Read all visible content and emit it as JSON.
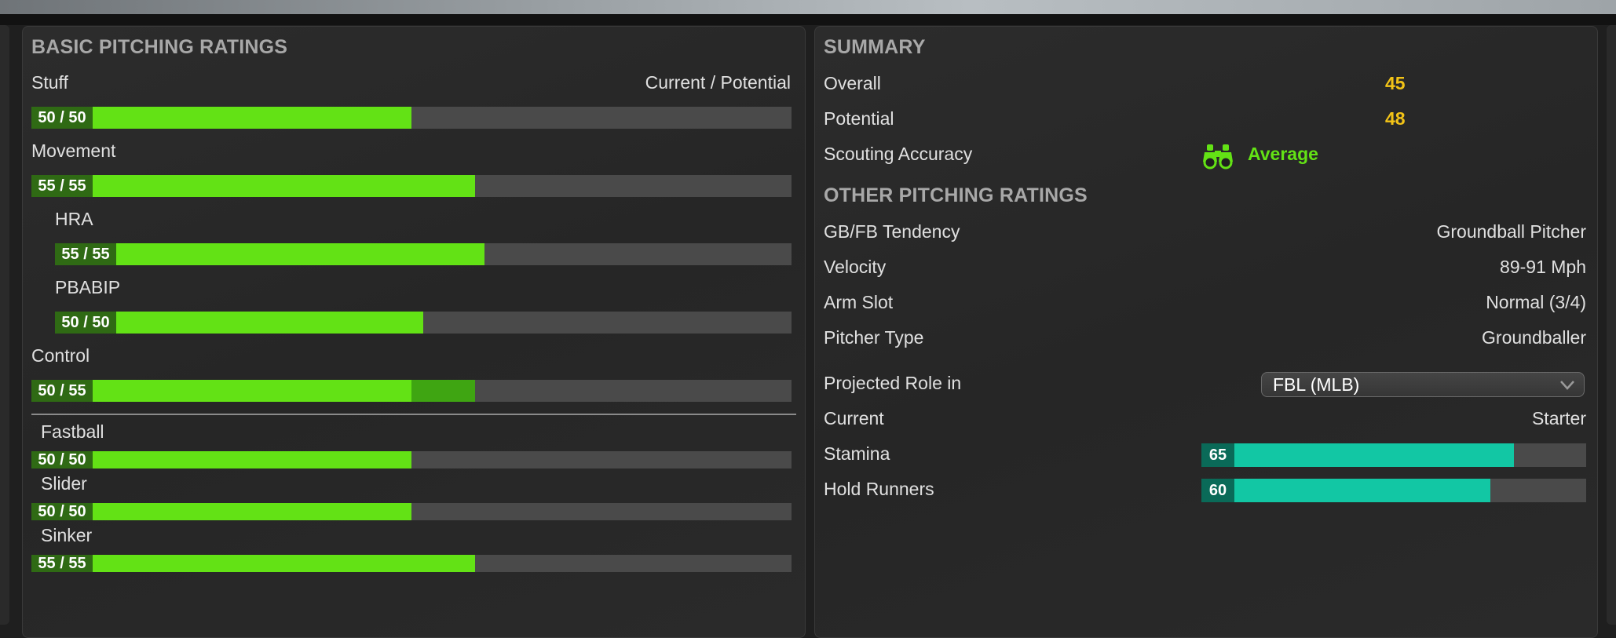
{
  "left_panel": {
    "title": "BASIC PITCHING RATINGS",
    "header_right": "Current / Potential",
    "ratings": [
      {
        "label": "Stuff",
        "value_text": "50 / 50",
        "current": 50,
        "potential": 50
      },
      {
        "label": "Movement",
        "value_text": "55 / 55",
        "current": 55,
        "potential": 55
      },
      {
        "label": "HRA",
        "value_text": "55 / 55",
        "current": 55,
        "potential": 55
      },
      {
        "label": "PBABIP",
        "value_text": "50 / 50",
        "current": 50,
        "potential": 50
      },
      {
        "label": "Control",
        "value_text": "50 / 55",
        "current": 50,
        "potential": 55
      }
    ],
    "pitches": [
      {
        "label": "Fastball",
        "value_text": "50 / 50",
        "current": 50,
        "potential": 50
      },
      {
        "label": "Slider",
        "value_text": "50 / 50",
        "current": 50,
        "potential": 50
      },
      {
        "label": "Sinker",
        "value_text": "55 / 55",
        "current": 55,
        "potential": 55
      }
    ]
  },
  "right_panel": {
    "title": "SUMMARY",
    "overall_label": "Overall",
    "overall_value": "45",
    "potential_label": "Potential",
    "potential_value": "48",
    "scouting_label": "Scouting Accuracy",
    "scouting_value": "Average",
    "other_title": "OTHER PITCHING RATINGS",
    "gbfb_label": "GB/FB Tendency",
    "gbfb_value": "Groundball Pitcher",
    "velocity_label": "Velocity",
    "velocity_value": "89-91 Mph",
    "armslot_label": "Arm Slot",
    "armslot_value": "Normal (3/4)",
    "pitcher_type_label": "Pitcher Type",
    "pitcher_type_value": "Groundballer",
    "projected_label": "Projected Role in",
    "projected_select": "FBL (MLB)",
    "current_label": "Current",
    "current_value": "Starter",
    "stamina_label": "Stamina",
    "stamina_value": "65",
    "hold_label": "Hold Runners",
    "hold_value": "60"
  },
  "colors": {
    "accent_green": "#63e215",
    "potential_green": "#3fa512",
    "teal": "#12c7a4",
    "yellow": "#f2c317"
  },
  "icons": {
    "scouting": "binoculars-icon",
    "select": "chevron-down-icon"
  }
}
